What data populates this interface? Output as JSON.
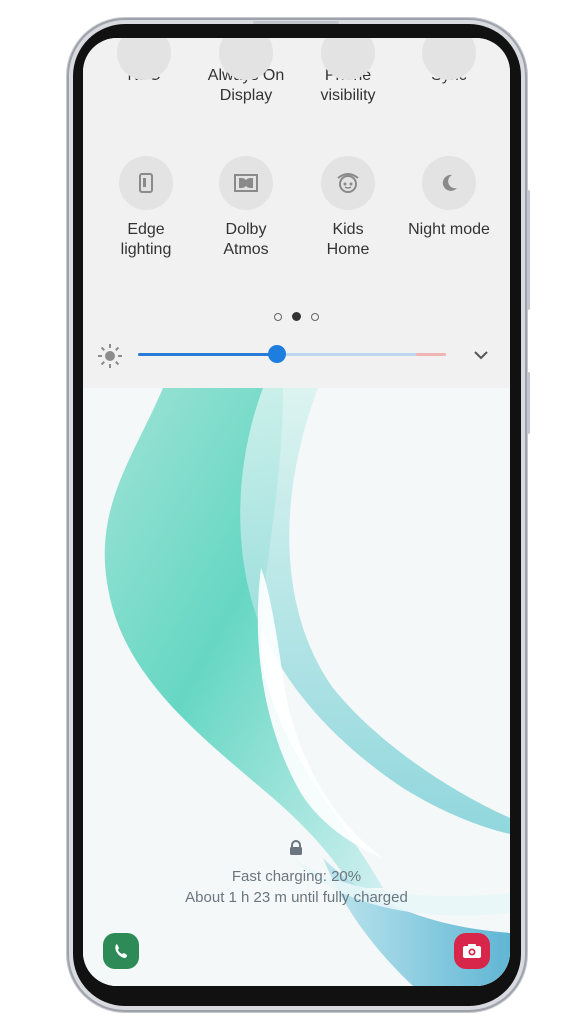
{
  "quick_panel": {
    "row1": [
      {
        "label": "NFC",
        "icon": "nfc-icon"
      },
      {
        "label": "Always On\nDisplay",
        "icon": "always-on-display-icon"
      },
      {
        "label": "Phone\nvisibility",
        "icon": "phone-visibility-icon"
      },
      {
        "label": "Sync",
        "icon": "sync-icon"
      }
    ],
    "row2": [
      {
        "label": "Edge\nlighting",
        "icon": "edge-lighting-icon"
      },
      {
        "label": "Dolby\nAtmos",
        "icon": "dolby-atmos-icon"
      },
      {
        "label": "Kids\nHome",
        "icon": "kids-home-icon"
      },
      {
        "label": "Night mode",
        "icon": "night-mode-icon"
      }
    ],
    "pages": {
      "count": 3,
      "active": 2
    },
    "brightness": {
      "level": 0.45,
      "icon": "sun-icon"
    }
  },
  "lock_screen": {
    "charging_line1": "Fast charging: 20%",
    "charging_line2": "About 1 h 23 m until fully charged",
    "left_shortcut": "phone-icon",
    "right_shortcut": "camera-icon",
    "colors": {
      "accent": "#1e7ee0",
      "phone_shortcut": "#2e8b57",
      "camera_shortcut": "#d7264a"
    }
  }
}
